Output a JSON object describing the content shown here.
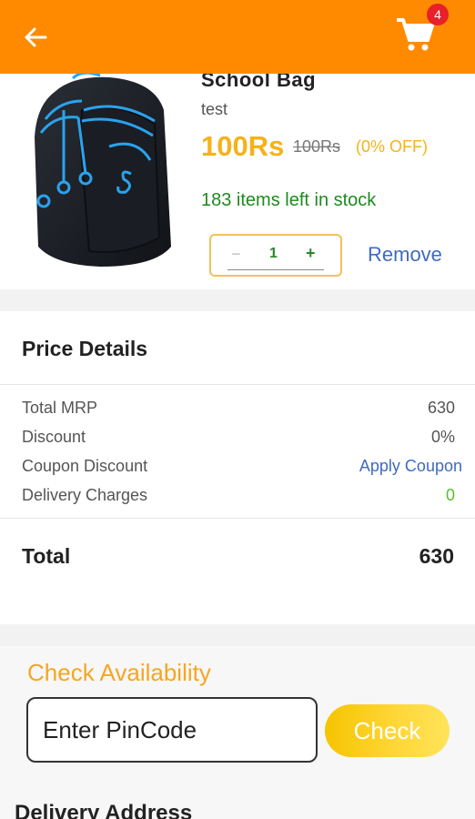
{
  "header": {
    "cart_count": "4",
    "colors": {
      "bar": "#ff8a00",
      "badge": "#e8202a"
    }
  },
  "product": {
    "title": "School Bag",
    "subtitle": "test",
    "price": "100Rs",
    "mrp": "100Rs",
    "discount": "(0% OFF)",
    "stock": "183 items left in stock",
    "quantity": "1",
    "minus_label": "−",
    "plus_label": "+",
    "remove_label": "Remove",
    "image_icon": "backpack-image"
  },
  "price_details": {
    "title": "Price Details",
    "rows": [
      {
        "label": "Total MRP",
        "value": "630"
      },
      {
        "label": "Discount",
        "value": "0%"
      },
      {
        "label": "Coupon Discount",
        "value": "Apply Coupon"
      },
      {
        "label": "Delivery Charges",
        "value": "0"
      }
    ],
    "total_label": "Total",
    "total_value": "630"
  },
  "availability": {
    "title": "Check Availability",
    "pincode_placeholder": "Enter PinCode",
    "check_label": "Check"
  },
  "delivery": {
    "title": "Delivery Address"
  }
}
